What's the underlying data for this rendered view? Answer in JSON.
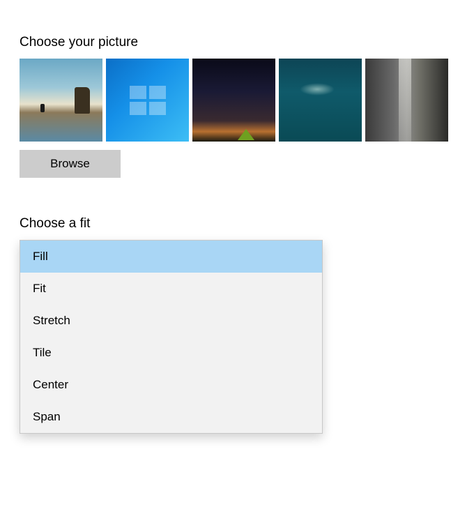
{
  "picture_section": {
    "label": "Choose your picture",
    "browse_label": "Browse",
    "thumbnails": [
      {
        "name": "beach-rock"
      },
      {
        "name": "windows-blue"
      },
      {
        "name": "night-camp"
      },
      {
        "name": "underwater"
      },
      {
        "name": "rock-waterfall"
      }
    ]
  },
  "fit_section": {
    "label": "Choose a fit",
    "selected_index": 0,
    "options": [
      {
        "label": "Fill"
      },
      {
        "label": "Fit"
      },
      {
        "label": "Stretch"
      },
      {
        "label": "Tile"
      },
      {
        "label": "Center"
      },
      {
        "label": "Span"
      }
    ]
  }
}
